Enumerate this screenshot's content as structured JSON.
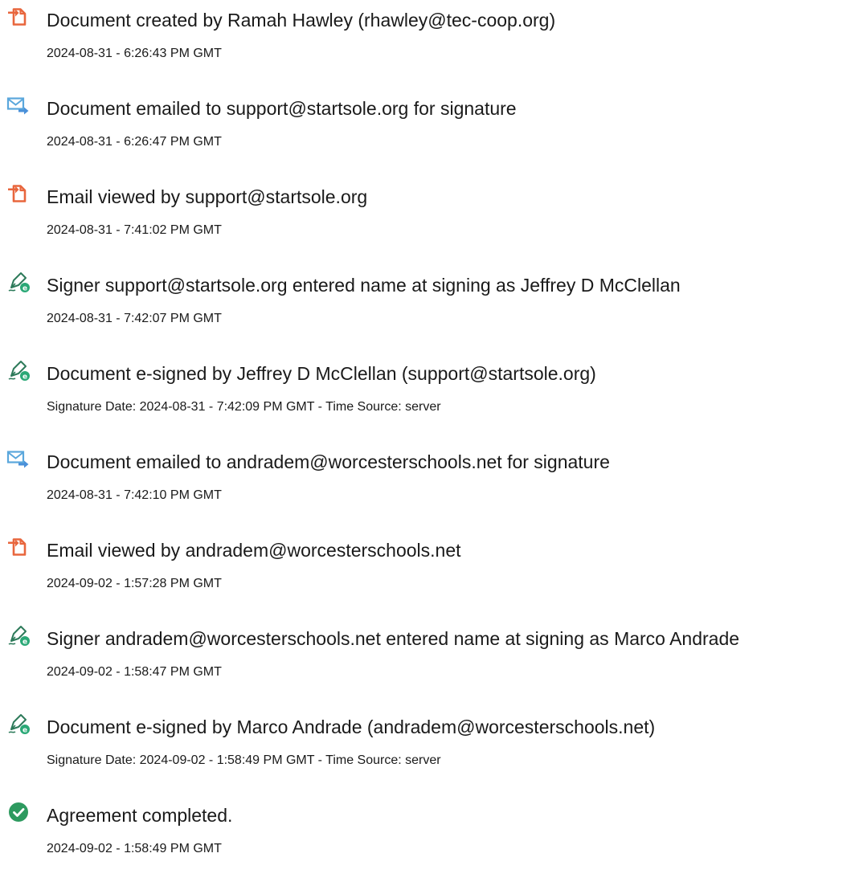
{
  "events": [
    {
      "icon": "document-created-icon",
      "title": "Document created by Ramah Hawley (rhawley@tec-coop.org)",
      "timestamp": "2024-08-31 - 6:26:43 PM GMT"
    },
    {
      "icon": "email-sent-icon",
      "title": "Document emailed to support@startsole.org for signature",
      "timestamp": "2024-08-31 - 6:26:47 PM GMT"
    },
    {
      "icon": "document-viewed-icon",
      "title": "Email viewed by support@startsole.org",
      "timestamp": "2024-08-31 - 7:41:02 PM GMT"
    },
    {
      "icon": "e-sign-pen-icon",
      "title": "Signer support@startsole.org entered name at signing as Jeffrey D McClellan",
      "timestamp": "2024-08-31 - 7:42:07 PM GMT"
    },
    {
      "icon": "e-sign-pen-icon",
      "title": "Document e-signed by Jeffrey D McClellan (support@startsole.org)",
      "timestamp": "Signature Date: 2024-08-31 - 7:42:09 PM GMT - Time Source: server"
    },
    {
      "icon": "email-sent-icon",
      "title": "Document emailed to andradem@worcesterschools.net for signature",
      "timestamp": "2024-08-31 - 7:42:10 PM GMT"
    },
    {
      "icon": "document-viewed-icon",
      "title": "Email viewed by andradem@worcesterschools.net",
      "timestamp": "2024-09-02 - 1:57:28 PM GMT"
    },
    {
      "icon": "e-sign-pen-icon",
      "title": "Signer andradem@worcesterschools.net entered name at signing as Marco Andrade",
      "timestamp": "2024-09-02 - 1:58:47 PM GMT"
    },
    {
      "icon": "e-sign-pen-icon",
      "title": "Document e-signed by Marco Andrade (andradem@worcesterschools.net)",
      "timestamp": "Signature Date: 2024-09-02 - 1:58:49 PM GMT - Time Source: server"
    },
    {
      "icon": "check-circle-icon",
      "title": "Agreement completed.",
      "timestamp": "2024-09-02 - 1:58:49 PM GMT"
    }
  ],
  "colors": {
    "document_icon": "#e8663d",
    "email_icon": "#5aa7dc",
    "pen_icon": "#2d7a5a",
    "pen_badge": "#2aa876",
    "complete_icon": "#2d9a5f"
  }
}
